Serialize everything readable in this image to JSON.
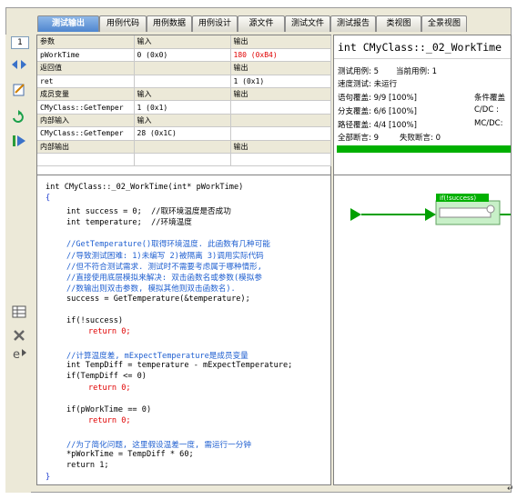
{
  "tabs": [
    {
      "label": "测试输出",
      "active": true
    },
    {
      "label": "用例代码",
      "active": false
    },
    {
      "label": "用例数据",
      "active": false
    },
    {
      "label": "用例设计",
      "active": false
    },
    {
      "label": "源文件",
      "active": false
    },
    {
      "label": "测试文件",
      "active": false
    },
    {
      "label": "测试报告",
      "active": false
    },
    {
      "label": "类视图",
      "active": false
    },
    {
      "label": "全景视图",
      "active": false
    }
  ],
  "toolbar": {
    "page_number": "1",
    "icons": [
      "navigate-arrows-icon",
      "edit-tool-icon",
      "refresh-icon",
      "step-run-icon",
      "table-view-icon",
      "delete-icon",
      "export-icon"
    ]
  },
  "param_table": {
    "rows": [
      {
        "c1": "参数",
        "c2": "输入",
        "c3": "输出",
        "header": true
      },
      {
        "c1": "pWorkTime",
        "c2": "0 (0x0)",
        "c3": "180 (0xB4)",
        "c3_red": true
      },
      {
        "c1": "返回值",
        "c2": "",
        "c3": "输出",
        "header": true
      },
      {
        "c1": "ret",
        "c2": "",
        "c3": "1 (0x1)"
      },
      {
        "c1": "成员变量",
        "c2": "输入",
        "c3": "输出",
        "header": true
      },
      {
        "c1": "CMyClass::GetTemper",
        "c2": "1 (0x1)",
        "c3": ""
      },
      {
        "c1": "内部输入",
        "c2": "输入",
        "c3": "",
        "header": true
      },
      {
        "c1": "CMyClass::GetTemper",
        "c2": "28 (0x1C)",
        "c3": ""
      },
      {
        "c1": "内部输出",
        "c2": "",
        "c3": "输出",
        "header": true
      },
      {
        "c1": "",
        "c2": "",
        "c3": ""
      }
    ]
  },
  "stats": {
    "title": "int CMyClass::_02_WorkTime",
    "test_cases_label": "测试用例: 5",
    "current_case_label": "当前用例: 1",
    "speed_label": "速度测试: 未运行",
    "stmt_coverage": "语句覆盖: 9/9 [100%]",
    "branch_coverage": "分支覆盖: 6/6 [100%]",
    "path_coverage": "路径覆盖: 4/4 [100%]",
    "condition_coverage": "条件覆盖",
    "cdc_label": "C/DC :",
    "mcdc_label": "MC/DC:",
    "assert_total": "全部断言: 9",
    "assert_failed": "失败断言: 0",
    "bar_color": "#00b000"
  },
  "code": [
    {
      "text": "int CMyClass::_02_WorkTime(int* pWorkTime)",
      "cls": "",
      "indent": 0
    },
    {
      "text": "{",
      "cls": "b",
      "indent": 0
    },
    {
      "text": "int success = 0;  //取环境温度是否成功",
      "cls": "",
      "indent": 1
    },
    {
      "text": "int temperature;  //环境温度",
      "cls": "",
      "indent": 1
    },
    {
      "text": "",
      "cls": "",
      "indent": 0
    },
    {
      "text": "//GetTemperature()取得环境温度. 此函数有几种可能",
      "cls": "c",
      "indent": 1
    },
    {
      "text": "//导致测试困难: 1)未编写 2)被隔离 3)调用实际代码",
      "cls": "c",
      "indent": 1
    },
    {
      "text": "//但不符合测试需求. 测试时不需要考虑属于哪种情形,",
      "cls": "c",
      "indent": 1
    },
    {
      "text": "//直接使用底层模拟来解决: 双击函数名或参数(模拟参",
      "cls": "c",
      "indent": 1
    },
    {
      "text": "//数输出则双击参数, 模拟其他则双击函数名).",
      "cls": "c",
      "indent": 1
    },
    {
      "text": "success = GetTemperature(&temperature);",
      "cls": "",
      "indent": 1
    },
    {
      "text": "",
      "cls": "",
      "indent": 0
    },
    {
      "text": "if(!success)",
      "cls": "",
      "indent": 1
    },
    {
      "text": "return 0;",
      "cls": "r",
      "indent": 2
    },
    {
      "text": "",
      "cls": "",
      "indent": 0
    },
    {
      "text": "//计算温度差, mExpectTemperature是成员变量",
      "cls": "c",
      "indent": 1
    },
    {
      "text": "int TempDiff = temperature - mExpectTemperature;",
      "cls": "",
      "indent": 1
    },
    {
      "text": "if(TempDiff <= 0)",
      "cls": "",
      "indent": 1
    },
    {
      "text": "return 0;",
      "cls": "r",
      "indent": 2
    },
    {
      "text": "",
      "cls": "",
      "indent": 0
    },
    {
      "text": "if(pWorkTime == 0)",
      "cls": "",
      "indent": 1
    },
    {
      "text": "return 0;",
      "cls": "r",
      "indent": 2
    },
    {
      "text": "",
      "cls": "",
      "indent": 0
    },
    {
      "text": "//为了简化问题, 这里假设温差一度, 需运行一分钟",
      "cls": "c",
      "indent": 1
    },
    {
      "text": "*pWorkTime = TempDiff * 60;",
      "cls": "",
      "indent": 1
    },
    {
      "text": "return 1;",
      "cls": "",
      "indent": 1
    },
    {
      "text": "}",
      "cls": "b",
      "indent": 0
    }
  ],
  "flow": {
    "node_label": "if(!success)",
    "line_color": "#00a000",
    "node_fill": "#c8f0c8"
  },
  "corner_mark": "↵"
}
